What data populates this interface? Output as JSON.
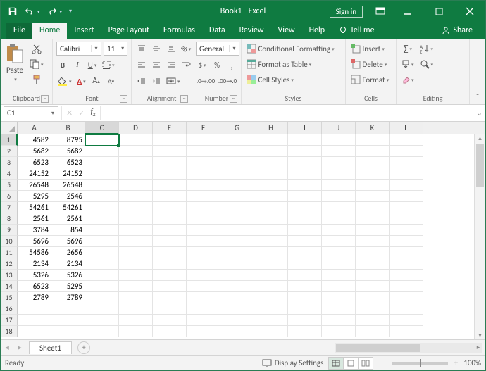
{
  "title": "Book1 - Excel",
  "signin": "Sign in",
  "tabs": {
    "file": "File",
    "home": "Home",
    "insert": "Insert",
    "pagelayout": "Page Layout",
    "formulas": "Formulas",
    "data": "Data",
    "review": "Review",
    "view": "View",
    "help": "Help",
    "tellme": "Tell me",
    "share": "Share"
  },
  "ribbon": {
    "clipboard": {
      "label": "Clipboard",
      "paste": "Paste"
    },
    "font": {
      "label": "Font",
      "name": "Calibri",
      "size": "11"
    },
    "alignment": {
      "label": "Alignment"
    },
    "number": {
      "label": "Number",
      "format": "General"
    },
    "styles": {
      "label": "Styles",
      "condfmt": "Conditional Formatting",
      "table": "Format as Table",
      "cellstyles": "Cell Styles"
    },
    "cells": {
      "label": "Cells",
      "insert": "Insert",
      "delete": "Delete",
      "format": "Format"
    },
    "editing": {
      "label": "Editing"
    }
  },
  "namebox": "C1",
  "sheet_name": "Sheet1",
  "columns": [
    "A",
    "B",
    "C",
    "D",
    "E",
    "F",
    "G",
    "H",
    "I",
    "J",
    "K",
    "L"
  ],
  "selected_col": "C",
  "selected_row": 1,
  "row_count": 18,
  "cells": {
    "A": [
      4582,
      5682,
      6523,
      24152,
      26548,
      5295,
      54261,
      2561,
      3784,
      5696,
      54586,
      2134,
      5326,
      6523,
      2789
    ],
    "B": [
      8795,
      5682,
      6523,
      24152,
      26548,
      2546,
      54261,
      2561,
      854,
      5696,
      2656,
      2134,
      5326,
      5295,
      2789
    ]
  },
  "status": {
    "ready": "Ready",
    "display": "Display Settings",
    "zoom": "100%"
  }
}
